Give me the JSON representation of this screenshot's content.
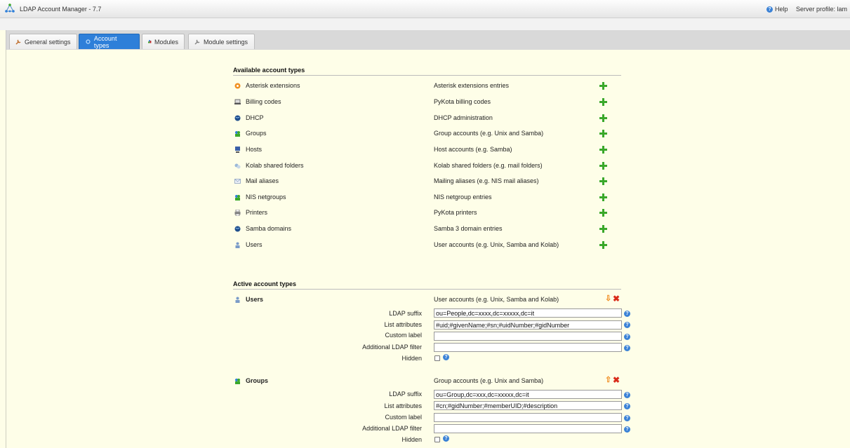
{
  "app": {
    "title": "LDAP Account Manager - 7.7",
    "help_label": "Help",
    "server_profile": "Server profile: lam"
  },
  "tabs": [
    {
      "label": "General settings",
      "icon": "wrench-icon"
    },
    {
      "label": "Account types",
      "icon": "gear-icon",
      "active": true
    },
    {
      "label": "Modules",
      "icon": "modules-icon"
    },
    {
      "label": "Module settings",
      "icon": "wrench-icon"
    }
  ],
  "available": {
    "title": "Available account types",
    "items": [
      {
        "name": "Asterisk extensions",
        "desc": "Asterisk extensions entries",
        "icon": "asterisk-icon"
      },
      {
        "name": "Billing codes",
        "desc": "PyKota billing codes",
        "icon": "billing-icon"
      },
      {
        "name": "DHCP",
        "desc": "DHCP administration",
        "icon": "dhcp-icon"
      },
      {
        "name": "Groups",
        "desc": "Group accounts (e.g. Unix and Samba)",
        "icon": "group-icon"
      },
      {
        "name": "Hosts",
        "desc": "Host accounts (e.g. Samba)",
        "icon": "host-icon"
      },
      {
        "name": "Kolab shared folders",
        "desc": "Kolab shared folders (e.g. mail folders)",
        "icon": "folder-icon"
      },
      {
        "name": "Mail aliases",
        "desc": "Mailing aliases (e.g. NIS mail aliases)",
        "icon": "mail-icon"
      },
      {
        "name": "NIS netgroups",
        "desc": "NIS netgroup entries",
        "icon": "netgroup-icon"
      },
      {
        "name": "Printers",
        "desc": "PyKota printers",
        "icon": "printer-icon"
      },
      {
        "name": "Samba domains",
        "desc": "Samba 3 domain entries",
        "icon": "samba-icon"
      },
      {
        "name": "Users",
        "desc": "User accounts (e.g. Unix, Samba and Kolab)",
        "icon": "user-icon"
      }
    ]
  },
  "active": {
    "title": "Active account types",
    "labels": {
      "suffix": "LDAP suffix",
      "attributes": "List attributes",
      "custom_label": "Custom label",
      "filter": "Additional LDAP filter",
      "hidden": "Hidden"
    },
    "types": [
      {
        "name": "Users",
        "desc": "User accounts (e.g. Unix, Samba and Kolab)",
        "suffix": "ou=People,dc=xxxx,dc=xxxxx,dc=it",
        "attributes": "#uid;#givenName;#sn;#uidNumber;#gidNumber",
        "custom_label": "",
        "filter": "",
        "move_arrow": "⇩"
      },
      {
        "name": "Groups",
        "desc": "Group accounts (e.g. Unix and Samba)",
        "suffix": "ou=Group,dc=xxx,dc=xxxxx,dc=it",
        "attributes": "#cn;#gidNumber;#memberUID;#description",
        "custom_label": "",
        "filter": "",
        "move_arrow": "⇧"
      }
    ]
  },
  "colors": {
    "background": "#fefee8",
    "active_tab": "#2e7fd9",
    "add_icon": "#3aa82a",
    "delete_icon": "#d92b1a",
    "move_icon": "#f08a1c"
  }
}
